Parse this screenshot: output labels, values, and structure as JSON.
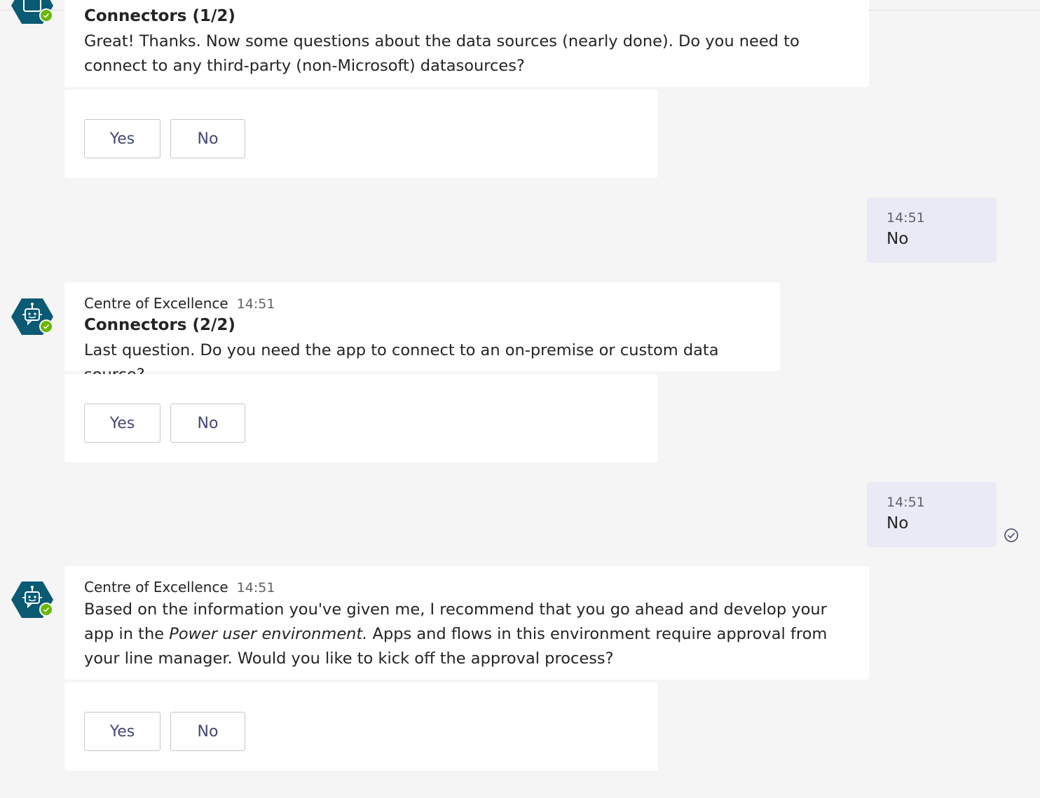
{
  "colors": {
    "background": "#f5f5f5",
    "bubble": "#ffffff",
    "user_bubble": "#e9eaf6",
    "avatar": "#0b5a74",
    "presence": "#6bb700",
    "button_text": "#464775"
  },
  "messages": [
    {
      "title": "Connectors (1/2)",
      "text": "Great! Thanks. Now some questions about the data sources (nearly done).  Do you need to connect to any third-party (non-Microsoft) datasources?",
      "actions": {
        "yes": "Yes",
        "no": "No"
      }
    },
    {
      "user_time": "14:51",
      "user_text": "No"
    },
    {
      "sender": "Centre of Excellence",
      "time": "14:51",
      "title": "Connectors (2/2)",
      "text": "Last question.  Do you need the app to connect to an on-premise or custom data source?",
      "actions": {
        "yes": "Yes",
        "no": "No"
      }
    },
    {
      "user_time": "14:51",
      "user_text": "No"
    },
    {
      "sender": "Centre of Excellence",
      "time": "14:51",
      "text_before": "Based on the information you've given me, I recommend that you go ahead and develop your app in the ",
      "text_italic": "Power user environment.",
      "text_after": "  Apps and flows in this environment require approval from your line manager.  Would you like to kick off the approval process?",
      "actions": {
        "yes": "Yes",
        "no": "No"
      }
    }
  ],
  "icons": {
    "avatar": "bot-icon",
    "presence": "check-icon",
    "read_receipt": "seen-check-icon"
  }
}
